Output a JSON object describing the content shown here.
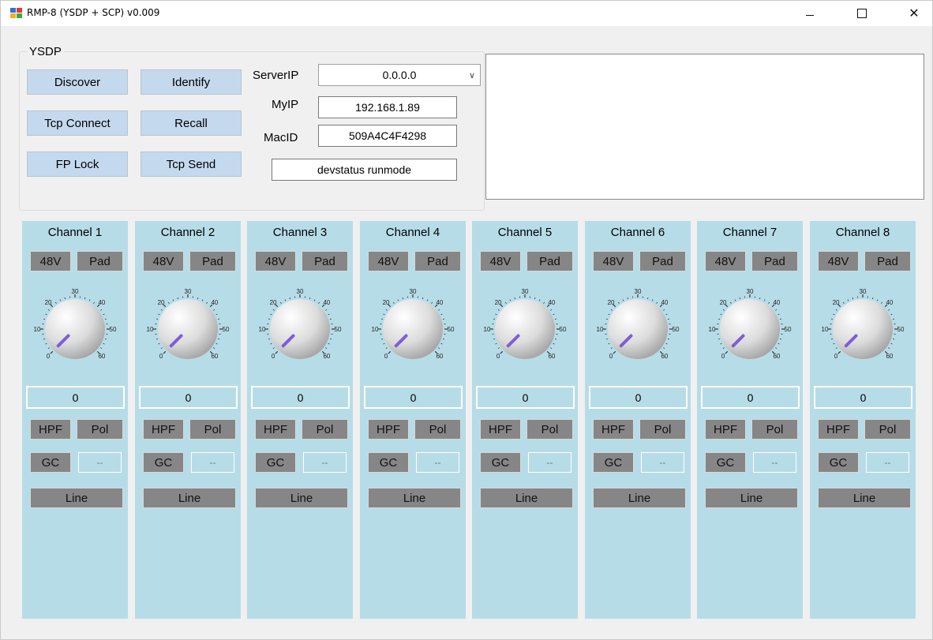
{
  "window": {
    "title": "RMP-8 (YSDP + SCP) v0.009",
    "controls": {
      "minimize": "–",
      "maximize": "□",
      "close": "✕"
    }
  },
  "ysdp": {
    "group_title": "YSDP",
    "buttons": {
      "discover": "Discover",
      "identify": "Identify",
      "tcp_connect": "Tcp Connect",
      "recall": "Recall",
      "fp_lock": "FP Lock",
      "tcp_send": "Tcp Send"
    },
    "server_ip": {
      "label": "ServerIP",
      "value": "0.0.0.0"
    },
    "my_ip": {
      "label": "MyIP",
      "value": "192.168.1.89"
    },
    "mac_id": {
      "label": "MacID",
      "value": "509A4C4F4298"
    },
    "command": "devstatus runmode"
  },
  "knob_scale": [
    "0",
    "10",
    "20",
    "30",
    "40",
    "50",
    "60"
  ],
  "channels": [
    {
      "name": "Channel 1",
      "phantom": "48V",
      "pad": "Pad",
      "gain": "0",
      "hpf": "HPF",
      "pol": "Pol",
      "gc": "GC",
      "gc_value": "--",
      "input": "Line"
    },
    {
      "name": "Channel 2",
      "phantom": "48V",
      "pad": "Pad",
      "gain": "0",
      "hpf": "HPF",
      "pol": "Pol",
      "gc": "GC",
      "gc_value": "--",
      "input": "Line"
    },
    {
      "name": "Channel 3",
      "phantom": "48V",
      "pad": "Pad",
      "gain": "0",
      "hpf": "HPF",
      "pol": "Pol",
      "gc": "GC",
      "gc_value": "--",
      "input": "Line"
    },
    {
      "name": "Channel 4",
      "phantom": "48V",
      "pad": "Pad",
      "gain": "0",
      "hpf": "HPF",
      "pol": "Pol",
      "gc": "GC",
      "gc_value": "--",
      "input": "Line"
    },
    {
      "name": "Channel 5",
      "phantom": "48V",
      "pad": "Pad",
      "gain": "0",
      "hpf": "HPF",
      "pol": "Pol",
      "gc": "GC",
      "gc_value": "--",
      "input": "Line"
    },
    {
      "name": "Channel 6",
      "phantom": "48V",
      "pad": "Pad",
      "gain": "0",
      "hpf": "HPF",
      "pol": "Pol",
      "gc": "GC",
      "gc_value": "--",
      "input": "Line"
    },
    {
      "name": "Channel 7",
      "phantom": "48V",
      "pad": "Pad",
      "gain": "0",
      "hpf": "HPF",
      "pol": "Pol",
      "gc": "GC",
      "gc_value": "--",
      "input": "Line"
    },
    {
      "name": "Channel 8",
      "phantom": "48V",
      "pad": "Pad",
      "gain": "0",
      "hpf": "HPF",
      "pol": "Pol",
      "gc": "GC",
      "gc_value": "--",
      "input": "Line"
    }
  ],
  "colors": {
    "channel_bg": "#b6dce8",
    "toggle_off": "#868686",
    "button_bg": "#c5d9ee",
    "knob_pointer": "#7b5fd6"
  }
}
